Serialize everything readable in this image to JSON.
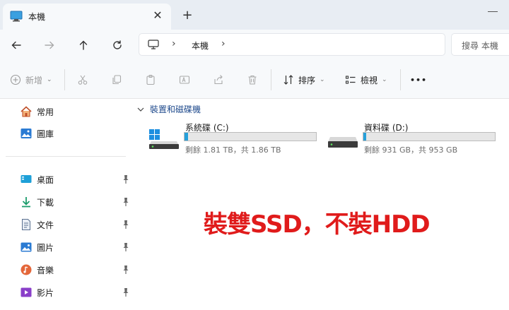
{
  "tab": {
    "title": "本機",
    "close_glyph": "✕",
    "new_tab_glyph": "+"
  },
  "address": {
    "location": "本機",
    "separator": "›",
    "search_placeholder": "搜尋 本機"
  },
  "toolbar": {
    "new_label": "新增",
    "sort_label": "排序",
    "view_label": "檢視",
    "more_glyph": "•••"
  },
  "sidebar": {
    "quick": [
      {
        "label": "常用",
        "icon": "home-icon"
      },
      {
        "label": "圖庫",
        "icon": "gallery-icon"
      }
    ],
    "pinned": [
      {
        "label": "桌面",
        "icon": "desktop-icon"
      },
      {
        "label": "下載",
        "icon": "download-icon"
      },
      {
        "label": "文件",
        "icon": "document-icon"
      },
      {
        "label": "圖片",
        "icon": "pictures-icon"
      },
      {
        "label": "音樂",
        "icon": "music-icon"
      },
      {
        "label": "影片",
        "icon": "videos-icon"
      }
    ]
  },
  "main": {
    "group_title": "裝置和磁碟機",
    "drives": [
      {
        "name": "系統碟 (C:)",
        "space": "剩餘 1.81 TB，共 1.86 TB",
        "used_fraction": 0.027,
        "icon": "system-drive-icon"
      },
      {
        "name": "資料碟 (D:)",
        "space": "剩餘 931 GB，共 953 GB",
        "used_fraction": 0.023,
        "icon": "data-drive-icon"
      }
    ],
    "annotation": "裝雙SSD，不裝HDD"
  },
  "colors": {
    "accent": "#26a0da",
    "annotation": "#e01b1b",
    "group_title": "#1f4a8c"
  }
}
